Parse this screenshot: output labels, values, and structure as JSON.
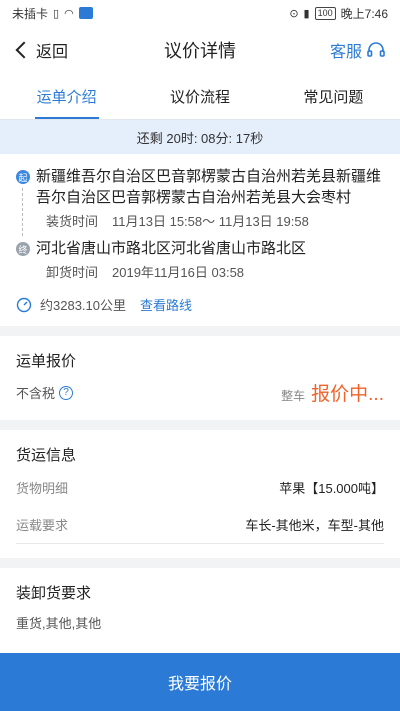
{
  "status_bar": {
    "carrier": "未插卡",
    "battery": "100",
    "time": "晚上7:46"
  },
  "header": {
    "back_label": "返回",
    "title": "议价详情",
    "service_label": "客服"
  },
  "tabs": [
    {
      "label": "运单介绍",
      "active": true
    },
    {
      "label": "议价流程",
      "active": false
    },
    {
      "label": "常见问题",
      "active": false
    }
  ],
  "countdown": "还剩 20时: 08分: 17秒",
  "route": {
    "start": {
      "pin": "起",
      "address": "新疆维吾尔自治区巴音郭楞蒙古自治州若羌县新疆维吾尔自治区巴音郭楞蒙古自治州若羌县大会枣村",
      "time_label": "装货时间",
      "time_value": "11月13日 15:58～ 11月13日 19:58"
    },
    "end": {
      "pin": "终",
      "address": "河北省唐山市路北区河北省唐山市路北区",
      "time_label": "卸货时间",
      "time_value": "2019年11月16日 03:58"
    },
    "distance": "约3283.10公里",
    "view_route": "查看路线"
  },
  "quote": {
    "title": "运单报价",
    "tax_label": "不含税",
    "vehicle_type": "整车",
    "status": "报价中..."
  },
  "cargo": {
    "title": "货运信息",
    "rows": [
      {
        "label": "货物明细",
        "value": "苹果【15.000吨】"
      },
      {
        "label": "运载要求",
        "value": "车长-其他米，车型-其他"
      }
    ]
  },
  "loading": {
    "title": "装卸货要求",
    "text": "重货,其他,其他"
  },
  "bottom_button": "我要报价",
  "colors": {
    "accent": "#2b7bd6",
    "price": "#f0622a",
    "countdown_bg": "#e5eefb"
  }
}
